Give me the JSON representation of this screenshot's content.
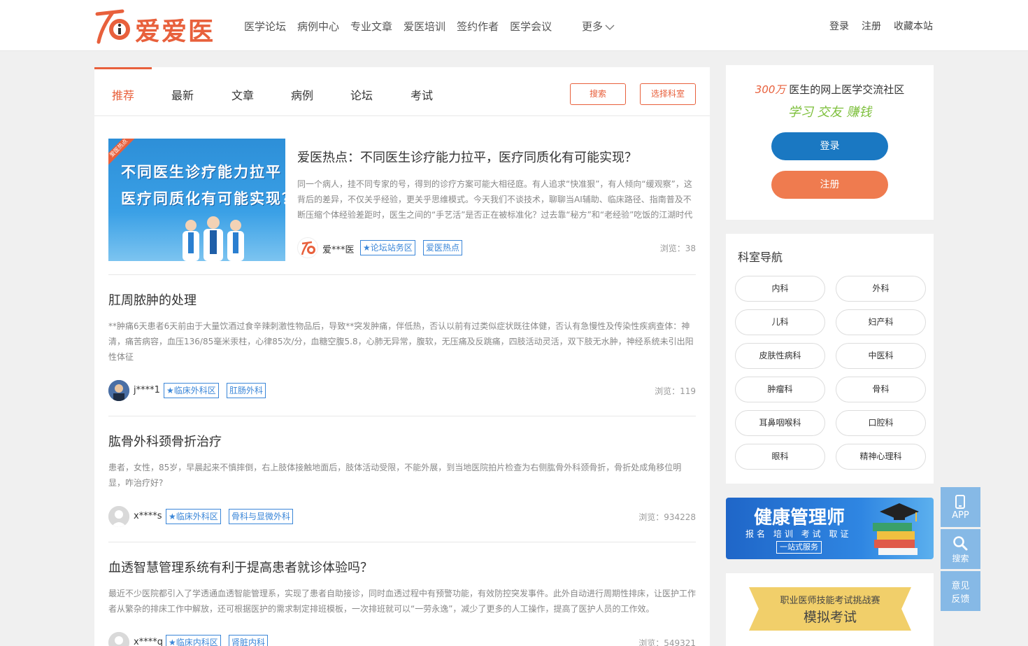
{
  "header": {
    "logo_text": "爱爱医",
    "nav": [
      "医学论坛",
      "病例中心",
      "专业文章",
      "爱医培训",
      "签约作者",
      "医学会议"
    ],
    "more_label": "更多",
    "user_links": [
      "登录",
      "注册",
      "收藏本站"
    ]
  },
  "tabs": {
    "items": [
      "推荐",
      "最新",
      "文章",
      "病例",
      "论坛",
      "考试"
    ],
    "active": "推荐",
    "search_button": "搜索",
    "dept_button": "选择科室"
  },
  "featured": {
    "image_line1": "不同医生诊疗能力拉平",
    "image_line2": "医疗同质化有可能实现？",
    "corner_label": "爱医热点",
    "title": "爱医热点：不同医生诊疗能力拉平，医疗同质化有可能实现？",
    "description": "同一个病人，挂不同专家的号，得到的诊疗方案可能大相径庭。有人追求“快准狠”，有人倾向“缓观察”，这背后的差异，不仅关乎经验，更关乎思维模式。今天我们不谈技术，聊聊当AI辅助、临床路径、指南普及不断压缩个体经验差距时，医生之间的“手艺活”是否正在被标准化？过去靠“秘方”和“老经验”吃饭的江湖时代正…",
    "author": "爱***医",
    "tags": [
      "★论坛站务区",
      "爱医热点"
    ],
    "views": "浏览：38"
  },
  "posts": [
    {
      "title": "肛周脓肿的处理",
      "description": "**肿痛6天患者6天前由于大量饮酒过食辛辣刺激性物品后，导致**突发肿痛，伴低热，否认以前有过类似症状既往体健，否认有急慢性及传染性疾病查体：神清，痛苦病容，血压136/85毫米汞柱，心律85次/分，血糖空腹5.8，心肺无异常，腹软，无压痛及反跳痛，四肢活动灵活，双下肢无水肿，神经系统未引出阳性体征",
      "author": "j****1",
      "tags": [
        "★临床外科区",
        "肛肠外科"
      ],
      "views": "浏览：119"
    },
    {
      "title": "肱骨外科颈骨折治疗",
      "description": "患者，女性，85岁，早晨起来不慎摔倒，右上肢体接触地面后，肢体活动受限，不能外展，到当地医院拍片检查为右侧肱骨外科颈骨折，骨折处成角移位明显，咋治疗好?",
      "author": "x****s",
      "tags": [
        "★临床外科区",
        "骨科与显微外科"
      ],
      "views": "浏览：934228"
    },
    {
      "title": "血透智慧管理系统有利于提高患者就诊体验吗？",
      "description": "最近不少医院都引入了学透通血透智能管理系，实现了患者自助接诊，同时血透过程中有预警功能，有效防控突发事件。此外自动进行周期性排床，让医护工作者从繁杂的排床工作中解放，还可根据医护的需求制定排班模板，一次排班就可以“一劳永逸”，减少了更多的人工操作，提高了医护人员的工作效。",
      "author": "x****q",
      "tags": [
        "★临床内科区",
        "肾脏内科"
      ],
      "views": "浏览：549321"
    }
  ],
  "sidebar": {
    "stat_number": "300万",
    "stat_text": "医生的网上医学交流社区",
    "slogan": "学习 交友 赚钱",
    "login_button": "登录",
    "register_button": "注册",
    "dept_title": "科室导航",
    "departments": [
      "内科",
      "外科",
      "儿科",
      "妇产科",
      "皮肤性病科",
      "中医科",
      "肿瘤科",
      "骨科",
      "耳鼻咽喉科",
      "口腔科",
      "眼科",
      "精神心理科"
    ],
    "banner": {
      "title": "健康管理师",
      "subtitle": "报名 培训 考试 取证",
      "badge": "一站式服务"
    },
    "exam": {
      "line1": "职业医师技能考试挑战赛",
      "line2": "模拟考试"
    }
  },
  "float_bar": {
    "app_label": "APP",
    "search_label": "搜索",
    "feedback_line1": "意见",
    "feedback_line2": "反馈"
  },
  "colors": {
    "brand_orange": "#e8603c",
    "link_blue": "#3a86d8",
    "login_blue": "#1a78c2",
    "slogan_green": "#7cbf3a",
    "float_blue": "#86b9e6"
  }
}
